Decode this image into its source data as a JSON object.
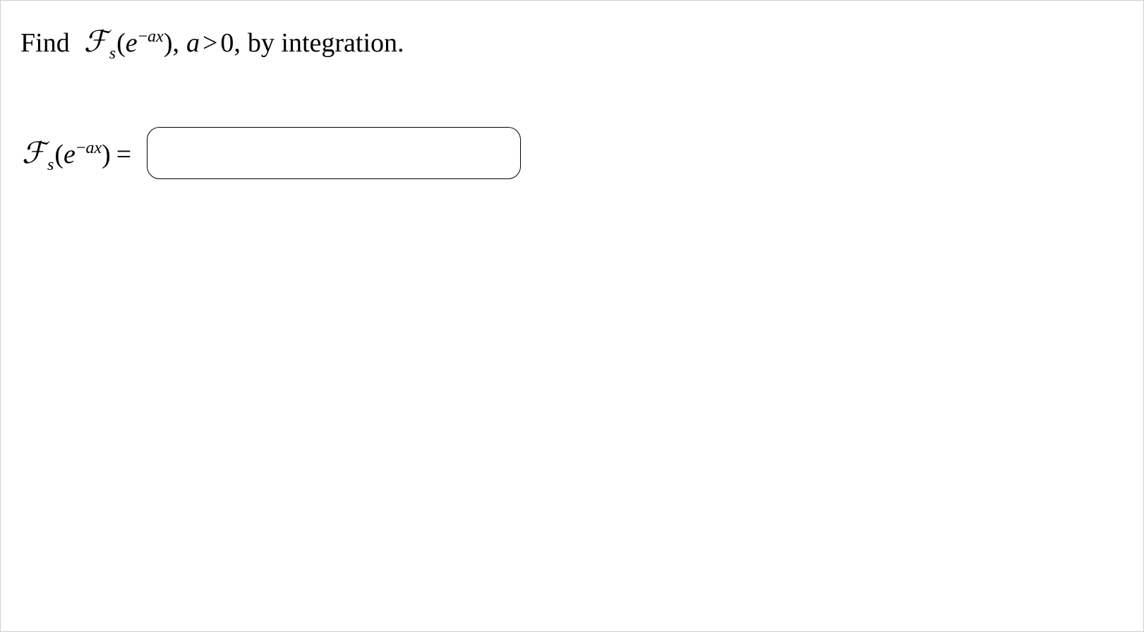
{
  "problem": {
    "leading": "Find",
    "find_expr": {
      "operator": "ℱ",
      "subscript": "s",
      "lparen": "(",
      "base": "e",
      "exponent_minus": "−",
      "exponent_a": "a",
      "exponent_x": "x",
      "rparen": ")"
    },
    "comma1": ",",
    "condition": {
      "var": "a",
      "rel": ">",
      "val": "0"
    },
    "comma2": ",",
    "trailing": "by integration."
  },
  "answer": {
    "lhs": {
      "operator": "ℱ",
      "subscript": "s",
      "lparen": "(",
      "base": "e",
      "exponent_minus": "−",
      "exponent_a": "a",
      "exponent_x": "x",
      "rparen": ")"
    },
    "eq": "=",
    "input_value": ""
  }
}
